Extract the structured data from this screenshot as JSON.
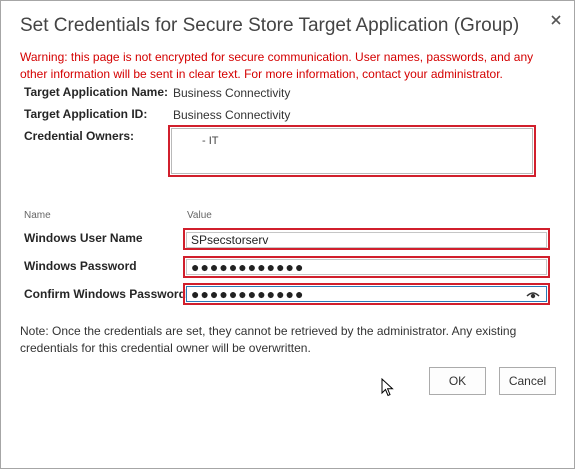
{
  "dialog": {
    "title": "Set Credentials for Secure Store Target Application (Group)",
    "close_icon": "close-icon",
    "warning": "Warning: this page is not encrypted for secure communication. User names, passwords, and any other information will be sent in clear text. For more information, contact your administrator."
  },
  "info": {
    "app_name_label": "Target Application Name:",
    "app_name_value": "Business Connectivity",
    "app_id_label": "Target Application ID:",
    "app_id_value": "Business Connectivity",
    "owners_label": "Credential Owners:",
    "owners_value": "- IT"
  },
  "fields": {
    "header_name": "Name",
    "header_value": "Value",
    "username_label": "Windows User Name",
    "username_value": "SPsecstorserv",
    "password_label": "Windows Password",
    "password_value": "●●●●●●●●●●●●",
    "confirm_label": "Confirm Windows Password",
    "confirm_value": "●●●●●●●●●●●●",
    "reveal_icon": "eye-icon"
  },
  "note": "Note: Once the credentials are set, they cannot be retrieved by the administrator. Any existing credentials for this credential owner will be overwritten.",
  "buttons": {
    "ok": "OK",
    "cancel": "Cancel"
  },
  "colors": {
    "highlight": "#d11f2c",
    "warning": "#d40000",
    "focus": "#2a7ab8"
  }
}
